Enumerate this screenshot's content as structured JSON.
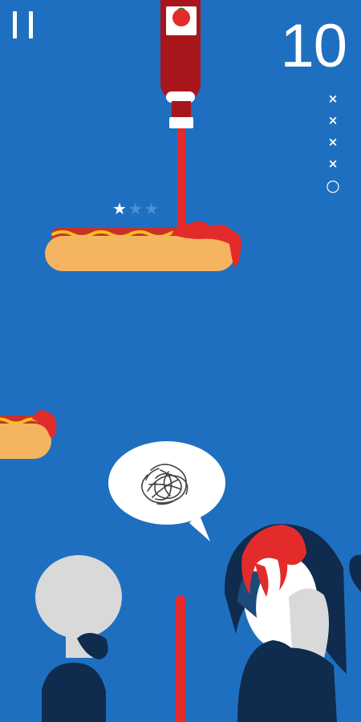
{
  "hud": {
    "score": "10",
    "attempts": [
      {
        "state": "missed",
        "symbol": "×"
      },
      {
        "state": "missed",
        "symbol": "×"
      },
      {
        "state": "missed",
        "symbol": "×"
      },
      {
        "state": "missed",
        "symbol": "×"
      },
      {
        "state": "remaining",
        "symbol": "○"
      }
    ]
  },
  "hotdog_rating": {
    "stars_filled": 1,
    "stars_total": 3,
    "filled_symbol": "★",
    "empty_symbol": "★"
  },
  "speech_bubble": {
    "content": "angry-scribble-icon"
  },
  "colors": {
    "background": "#1f6fc0",
    "ketchup": "#e32b2b",
    "bottle": "#a8161c",
    "bun": "#f5b460",
    "mustard": "#f4c21f",
    "sausage": "#c7322a",
    "hud_text": "#ffffff",
    "star_empty": "#4d8fd4",
    "crowd_dark": "#0f2b4d",
    "crowd_pale": "#d9d9d9"
  }
}
